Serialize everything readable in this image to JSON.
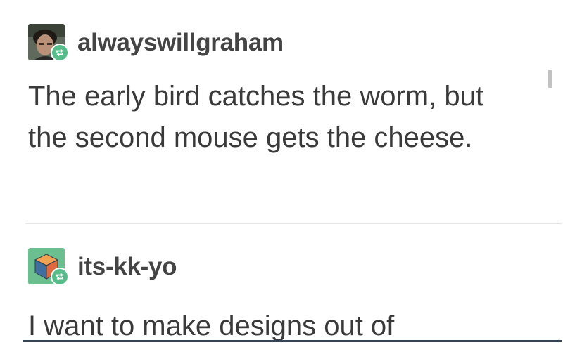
{
  "posts": [
    {
      "username": "alwayswillgraham",
      "avatar": "user-photo-avatar",
      "badge_icon": "reblog-icon",
      "text": "The early bird catches the worm, but the second mouse gets the cheese."
    },
    {
      "username": "its-kk-yo",
      "avatar": "cube-avatar",
      "badge_icon": "reblog-icon",
      "text": "I want to make designs out of"
    }
  ],
  "colors": {
    "reblog_badge": "#56bc8a",
    "text": "#3a3a3a",
    "username": "#444444",
    "divider": "#e6e6e6",
    "bottom_rule": "#35465c"
  }
}
